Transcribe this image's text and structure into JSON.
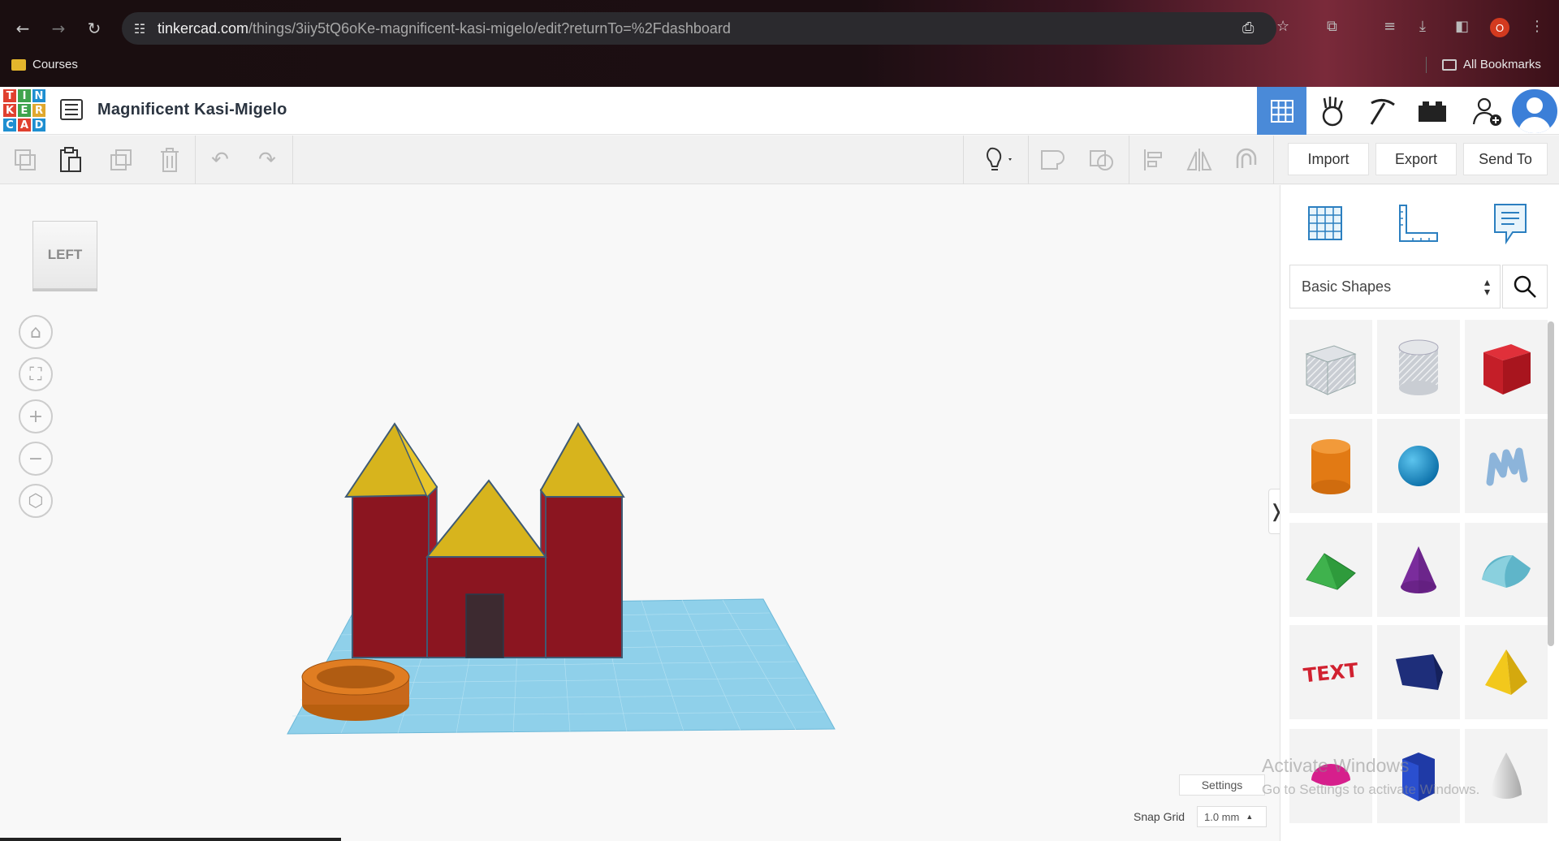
{
  "browser": {
    "url_host": "tinkercad.com",
    "url_path": "/things/3iiy5tQ6oKe-magnificent-kasi-migelo/edit?returnTo=%2Fdashboard",
    "profile_badge": "O",
    "bookmarks": [
      {
        "label": "Courses"
      },
      {
        "label": "All Bookmarks"
      }
    ]
  },
  "app": {
    "logo_letters": [
      "T",
      "I",
      "N",
      "K",
      "E",
      "R",
      "C",
      "A",
      "D"
    ],
    "logo_colors": [
      "#e0402f",
      "#3fa34d",
      "#1f8fd1",
      "#e0402f",
      "#3fa34d",
      "#e0a82e",
      "#1f8fd1",
      "#e0402f",
      "#1f8fd1"
    ],
    "design_title": "Magnificent Kasi-Migelo",
    "accent": "#4a8ad8"
  },
  "toolbar": {
    "import_label": "Import",
    "export_label": "Export",
    "send_to_label": "Send To"
  },
  "viewport": {
    "view_cube_face": "LEFT",
    "settings_label": "Settings",
    "snap_grid_label": "Snap Grid",
    "snap_grid_value": "1.0 mm"
  },
  "panel": {
    "shape_category": "Basic Shapes",
    "shapes": [
      {
        "name": "Box (hole)",
        "icon": "box-hole-icon"
      },
      {
        "name": "Cylinder (hole)",
        "icon": "cylinder-hole-icon"
      },
      {
        "name": "Box",
        "icon": "box-red-icon"
      },
      {
        "name": "Cylinder",
        "icon": "cylinder-orange-icon"
      },
      {
        "name": "Sphere",
        "icon": "sphere-blue-icon"
      },
      {
        "name": "Scribble",
        "icon": "scribble-icon"
      },
      {
        "name": "Roof",
        "icon": "roof-green-icon"
      },
      {
        "name": "Cone",
        "icon": "cone-purple-icon"
      },
      {
        "name": "Round Roof",
        "icon": "round-roof-icon"
      },
      {
        "name": "Text",
        "icon": "text-shape-icon"
      },
      {
        "name": "Wedge",
        "icon": "wedge-navy-icon"
      },
      {
        "name": "Pyramid",
        "icon": "pyramid-yellow-icon"
      },
      {
        "name": "Half Sphere",
        "icon": "half-sphere-icon"
      },
      {
        "name": "Polygon",
        "icon": "polygon-icon"
      },
      {
        "name": "Paraboloid",
        "icon": "paraboloid-icon"
      }
    ]
  },
  "os_watermark": {
    "line1": "Activate Windows",
    "line2": "Go to Settings to activate Windows."
  }
}
